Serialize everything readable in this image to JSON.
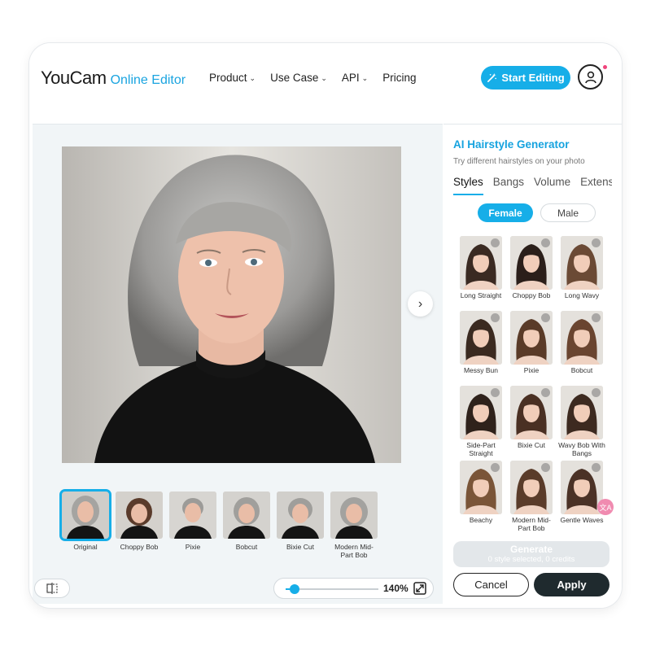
{
  "header": {
    "logo_main": "YouCam",
    "logo_sub": "Online Editor",
    "nav": [
      {
        "label": "Product",
        "has_dropdown": true
      },
      {
        "label": "Use Case",
        "has_dropdown": true
      },
      {
        "label": "API",
        "has_dropdown": true
      },
      {
        "label": "Pricing",
        "has_dropdown": false
      }
    ],
    "start_button": "Start Editing",
    "start_icon": "magic-wand-icon",
    "account_icon": "user-icon"
  },
  "canvas": {
    "next_icon": "chevron-right-icon",
    "results": [
      {
        "label": "Original",
        "selected": true
      },
      {
        "label": "Choppy Bob",
        "selected": false
      },
      {
        "label": "Pixie",
        "selected": false
      },
      {
        "label": "Bobcut",
        "selected": false
      },
      {
        "label": "Bixie Cut",
        "selected": false
      },
      {
        "label": "Modern Mid-Part Bob",
        "selected": false
      }
    ],
    "zoom_level": "140%",
    "zoom_fraction": 0.1,
    "compare_icon": "compare-icon",
    "expand_icon": "expand-icon"
  },
  "panel": {
    "title": "AI Hairstyle Generator",
    "subtitle": "Try different hairstyles on your photo",
    "tabs": [
      "Styles",
      "Bangs",
      "Volume",
      "Extens"
    ],
    "active_tab": "Styles",
    "gender": {
      "female": "Female",
      "male": "Male",
      "selected": "Female"
    },
    "styles": [
      {
        "label": "Long Straight",
        "hair": "#3a2a22"
      },
      {
        "label": "Choppy Bob",
        "hair": "#2b1f1a"
      },
      {
        "label": "Long Wavy",
        "hair": "#6b4a35"
      },
      {
        "label": "Messy Bun",
        "hair": "#3b2a20"
      },
      {
        "label": "Pixie",
        "hair": "#5a3b28"
      },
      {
        "label": "Bobcut",
        "hair": "#6a4530"
      },
      {
        "label": "Side-Part Straight",
        "hair": "#2f221b"
      },
      {
        "label": "Bixie Cut",
        "hair": "#4a3023"
      },
      {
        "label": "Wavy Bob With Bangs",
        "hair": "#3d2a20"
      },
      {
        "label": "Beachy",
        "hair": "#7a5538"
      },
      {
        "label": "Modern Mid-Part Bob",
        "hair": "#5a3c2a"
      },
      {
        "label": "Gentle Waves",
        "hair": "#4b3226"
      }
    ],
    "generate_label": "Generate",
    "generate_sub": "0 style selected, 0 credits",
    "cancel": "Cancel",
    "apply": "Apply",
    "translate_icon": "translate-icon"
  },
  "colors": {
    "accent": "#16aee8",
    "dark_button": "#1f2a2e",
    "notification_dot": "#f0447c"
  }
}
